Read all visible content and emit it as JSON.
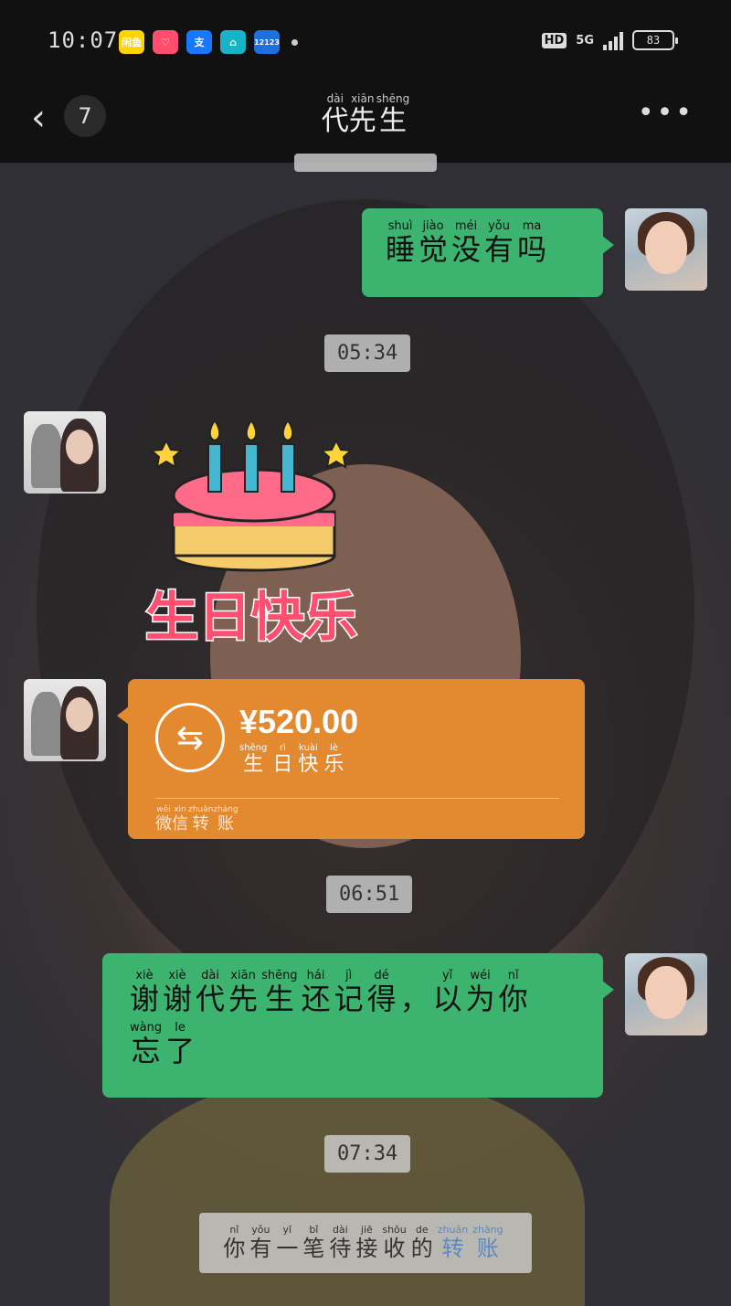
{
  "status_bar": {
    "time": "10:07",
    "apps": [
      {
        "name": "xianyu-app-icon",
        "label": "闲鱼",
        "color": "#ffd400"
      },
      {
        "name": "heart-app-icon",
        "label": "♡",
        "color": "#ff4d6d"
      },
      {
        "name": "alipay-app-icon",
        "label": "支",
        "color": "#1677ff"
      },
      {
        "name": "home-app-icon",
        "label": "⌂",
        "color": "#17b3c9"
      },
      {
        "name": "12123-app-icon",
        "label": "12123",
        "color": "#1e6fe0"
      }
    ],
    "hd_label": "HD",
    "network_label": "5G",
    "battery": "83"
  },
  "header": {
    "back_icon": "chevron-left-icon",
    "unread_count": "7",
    "title": [
      {
        "char": "代",
        "pinyin": "dài"
      },
      {
        "char": "先",
        "pinyin": "xiān"
      },
      {
        "char": "生",
        "pinyin": "shēng"
      }
    ],
    "more_icon": "ellipsis-icon"
  },
  "timestamps": [
    "05:34",
    "06:51",
    "07:34"
  ],
  "messages": {
    "sleep": [
      {
        "char": "睡",
        "pinyin": "shuì"
      },
      {
        "char": "觉",
        "pinyin": "jiào"
      },
      {
        "char": "没",
        "pinyin": "méi"
      },
      {
        "char": "有",
        "pinyin": "yǒu"
      },
      {
        "char": "吗",
        "pinyin": "ma"
      }
    ],
    "sticker_text": "生日快乐",
    "transfer": {
      "amount": "¥520.00",
      "memo": [
        {
          "char": "生",
          "pinyin": "shēng"
        },
        {
          "char": "日",
          "pinyin": "rì"
        },
        {
          "char": "快",
          "pinyin": "kuài"
        },
        {
          "char": "乐",
          "pinyin": "lè"
        }
      ],
      "label": [
        {
          "char": "微",
          "pinyin": "wēi"
        },
        {
          "char": "信",
          "pinyin": "xìn"
        },
        {
          "char": "转",
          "pinyin": "zhuǎn"
        },
        {
          "char": "账",
          "pinyin": "zhàng"
        }
      ]
    },
    "thanks_line1": [
      {
        "char": "谢",
        "pinyin": "xiè"
      },
      {
        "char": "谢",
        "pinyin": "xiè"
      },
      {
        "char": "代",
        "pinyin": "dài"
      },
      {
        "char": "先",
        "pinyin": "xiān"
      },
      {
        "char": "生",
        "pinyin": "shēng"
      },
      {
        "char": "还",
        "pinyin": "hái"
      },
      {
        "char": "记",
        "pinyin": "jì"
      },
      {
        "char": "得",
        "pinyin": "dé"
      },
      {
        "char": "，",
        "pinyin": ""
      },
      {
        "char": "以",
        "pinyin": "yǐ"
      },
      {
        "char": "为",
        "pinyin": "wéi"
      },
      {
        "char": "你",
        "pinyin": "nǐ"
      }
    ],
    "thanks_line2": [
      {
        "char": "忘",
        "pinyin": "wàng"
      },
      {
        "char": "了",
        "pinyin": "le"
      }
    ]
  },
  "notice": {
    "text": [
      {
        "char": "你",
        "pinyin": "nǐ"
      },
      {
        "char": "有",
        "pinyin": "yǒu"
      },
      {
        "char": "一",
        "pinyin": "yī"
      },
      {
        "char": "笔",
        "pinyin": "bǐ"
      },
      {
        "char": "待",
        "pinyin": "dài"
      },
      {
        "char": "接",
        "pinyin": "jiē"
      },
      {
        "char": "收",
        "pinyin": "shōu"
      },
      {
        "char": "的",
        "pinyin": "de"
      }
    ],
    "link": [
      {
        "char": "转",
        "pinyin": "zhuǎn"
      },
      {
        "char": "账",
        "pinyin": "zhàng"
      }
    ]
  }
}
